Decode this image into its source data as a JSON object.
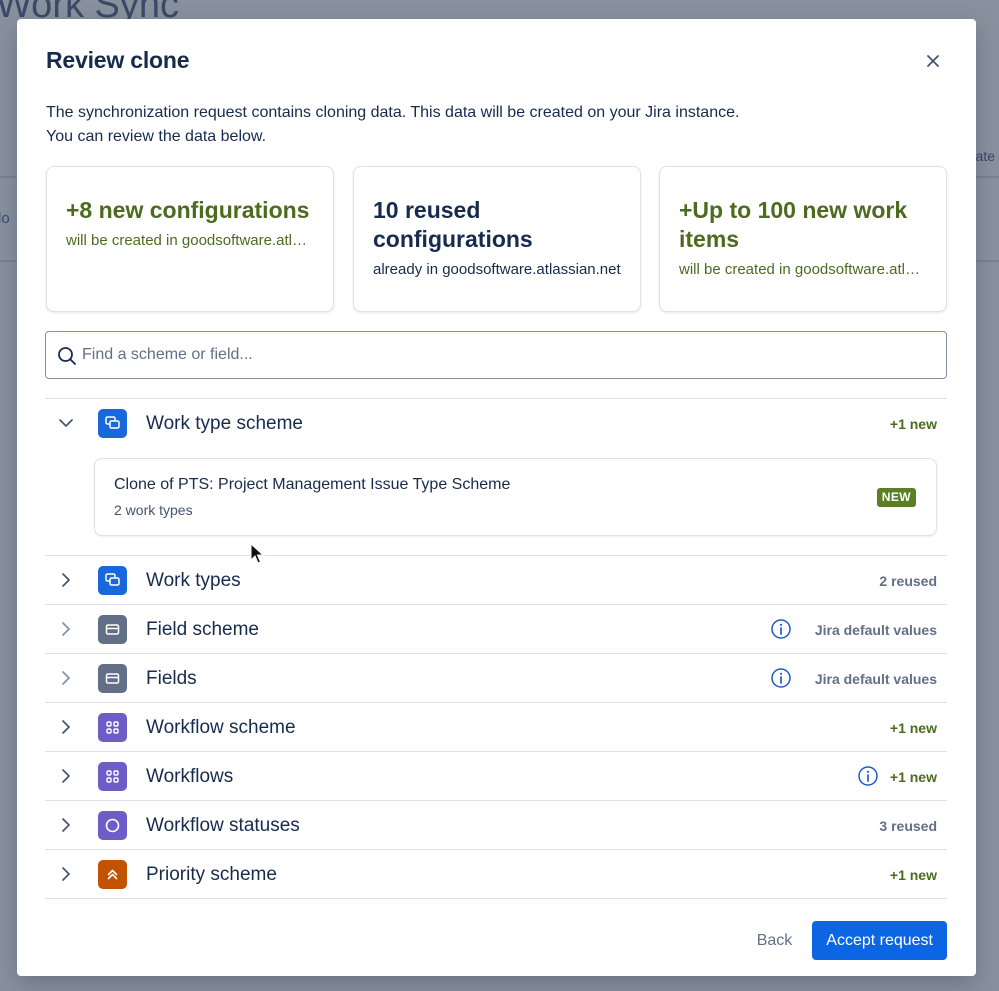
{
  "background": {
    "title": "Work Sync",
    "left_fragment": "lo",
    "right_fragment": "ate"
  },
  "modal": {
    "title": "Review clone",
    "close_icon": "close-icon",
    "intro_line1": "The synchronization request contains cloning data. This data will be created on your Jira instance.",
    "intro_line2": "You can review the data below."
  },
  "cards": [
    {
      "title": "+8 new configurations",
      "subtitle": "will be created in goodsoftware.atlassian.net",
      "tone": "green"
    },
    {
      "title": "10 reused configurations",
      "subtitle": "already in goodsoftware.atlassian.net",
      "tone": "dark"
    },
    {
      "title": "+Up to 100 new work items",
      "subtitle": "will be created in goodsoftware.atlassian.net",
      "tone": "green"
    }
  ],
  "search": {
    "placeholder": "Find a scheme or field...",
    "value": ""
  },
  "rows": [
    {
      "label": "Work type scheme",
      "meta": "+1 new",
      "meta_tone": "green",
      "expanded": true,
      "icon": "work-type-icon",
      "icon_color": "#1868db",
      "info": false
    },
    {
      "label": "Work types",
      "meta": "2 reused",
      "meta_tone": "grey",
      "expanded": false,
      "icon": "work-type-icon",
      "icon_color": "#1868db",
      "info": false
    },
    {
      "label": "Field scheme",
      "meta": "Jira default values",
      "meta_tone": "grey",
      "expanded": false,
      "icon": "field-icon",
      "icon_color": "#626f86",
      "info": true
    },
    {
      "label": "Fields",
      "meta": "Jira default values",
      "meta_tone": "grey",
      "expanded": false,
      "icon": "field-icon",
      "icon_color": "#626f86",
      "info": true
    },
    {
      "label": "Workflow scheme",
      "meta": "+1 new",
      "meta_tone": "green",
      "expanded": false,
      "icon": "workflow-icon",
      "icon_color": "#6e5dc6",
      "info": false
    },
    {
      "label": "Workflows",
      "meta": "+1 new",
      "meta_tone": "green",
      "expanded": false,
      "icon": "workflow-icon",
      "icon_color": "#6e5dc6",
      "info": true
    },
    {
      "label": "Workflow statuses",
      "meta": "3 reused",
      "meta_tone": "grey",
      "expanded": false,
      "icon": "status-icon",
      "icon_color": "#6e5dc6",
      "info": false
    },
    {
      "label": "Priority scheme",
      "meta": "+1 new",
      "meta_tone": "green",
      "expanded": false,
      "icon": "priority-icon",
      "icon_color": "#c25100",
      "info": false
    }
  ],
  "expanded_item": {
    "title": "Clone of PTS: Project Management Issue Type Scheme",
    "meta": "2 work types",
    "badge": "NEW"
  },
  "footer": {
    "back_label": "Back",
    "accept_label": "Accept request"
  },
  "colors": {
    "accent": "#0c66e4",
    "success_text": "#4c6b1f",
    "success_badge": "#5b7f24"
  }
}
